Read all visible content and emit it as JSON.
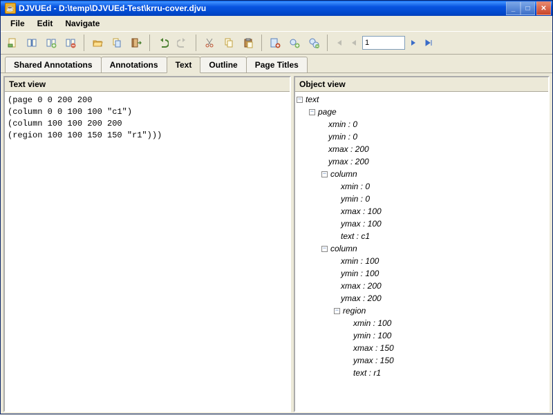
{
  "window": {
    "title": "DJVUEd - D:\\temp\\DJVUEd-Test\\krru-cover.djvu"
  },
  "menu": {
    "file": "File",
    "edit": "Edit",
    "navigate": "Navigate"
  },
  "toolbar": {
    "page_number": "1",
    "icons": [
      "new-doc",
      "open-book",
      "book-add",
      "book-remove",
      "folder-open",
      "copy-doc",
      "exit-door",
      "undo",
      "redo",
      "cut",
      "copy",
      "paste",
      "node-add",
      "node-edit",
      "node-delete",
      "nav-first",
      "nav-prev",
      "page-input",
      "nav-next",
      "nav-last"
    ]
  },
  "tabs": {
    "shared_annotations": "Shared Annotations",
    "annotations": "Annotations",
    "text": "Text",
    "outline": "Outline",
    "page_titles": "Page Titles",
    "active": "text"
  },
  "panels": {
    "text_view_title": "Text view",
    "object_view_title": "Object view"
  },
  "text_view": {
    "line1": "(page 0 0 200 200",
    "line2": " (column 0 0 100 100 \"c1\")",
    "line3": " (column 100 100 200 200",
    "line4": "  (region 100 100 150 150 \"r1\")))"
  },
  "tree": {
    "root": "text",
    "page": {
      "label": "page",
      "xmin": "xmin : 0",
      "ymin": "ymin : 0",
      "xmax": "xmax : 200",
      "ymax": "ymax : 200"
    },
    "col1": {
      "label": "column",
      "xmin": "xmin : 0",
      "ymin": "ymin : 0",
      "xmax": "xmax : 100",
      "ymax": "ymax : 100",
      "text": "text : c1"
    },
    "col2": {
      "label": "column",
      "xmin": "xmin : 100",
      "ymin": "ymin : 100",
      "xmax": "xmax : 200",
      "ymax": "ymax : 200"
    },
    "region": {
      "label": "region",
      "xmin": "xmin : 100",
      "ymin": "ymin : 100",
      "xmax": "xmax : 150",
      "ymax": "ymax : 150",
      "text": "text : r1"
    }
  }
}
